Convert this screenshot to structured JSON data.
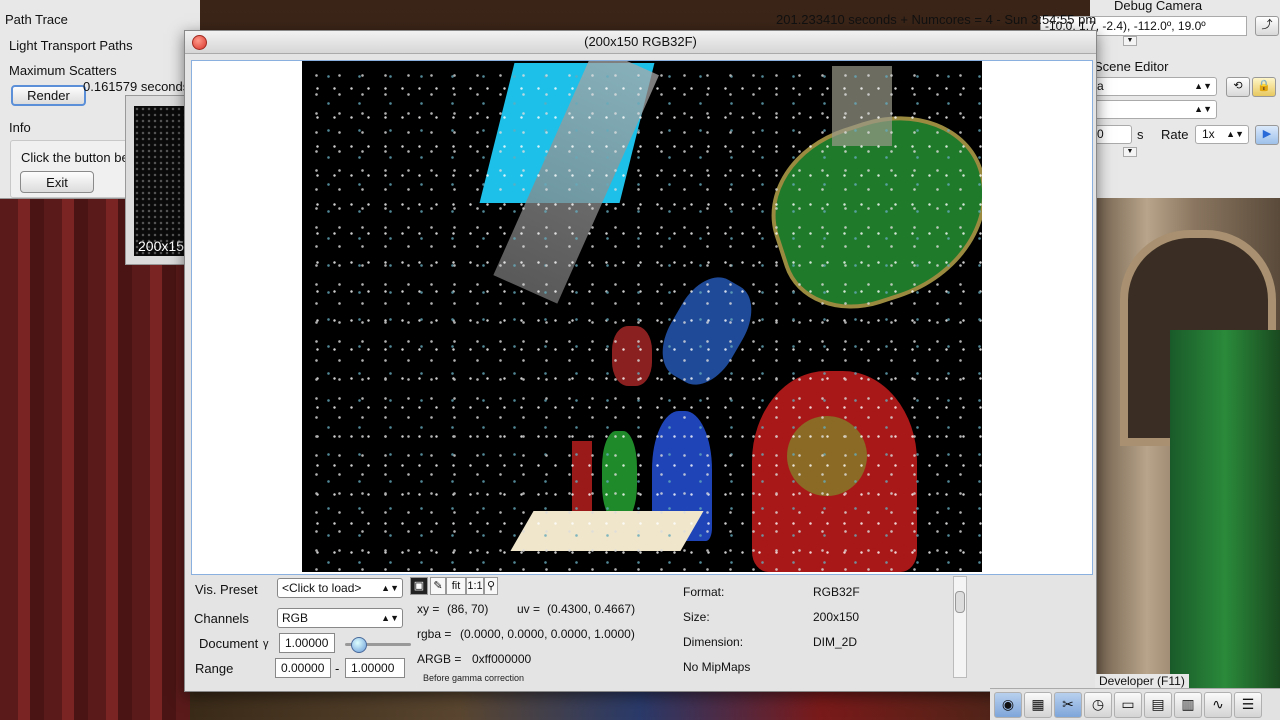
{
  "gui": {
    "panel_title": "Path Trace",
    "light_transport_label": "Light Transport Paths",
    "max_scatters_label": "Maximum Scatters",
    "render_button": "Render",
    "render_time": "0.161579 seconds",
    "info_label": "Info",
    "info_text": "Click the button be",
    "exit_button": "Exit",
    "thumbnail_caption": "200x15"
  },
  "status": {
    "text": "201.233410 seconds + Numcores = 4 - Sun 3:54:55 pm"
  },
  "debug_camera": {
    "title": "Debug Camera",
    "position": "-10.0, 1.7, -2.4), -112.0º, 19.0º"
  },
  "scene_editor": {
    "title": "Scene Editor",
    "scene_value": "a",
    "second_value": "",
    "time_value": "0",
    "time_unit": "s",
    "rate_label": "Rate",
    "rate_value": "1x"
  },
  "viewer": {
    "title": "(200x150 RGB32F)",
    "vis_preset_label": "Vis. Preset",
    "vis_preset_value": "<Click to load>",
    "channels_label": "Channels",
    "channels_value": "RGB",
    "document_label": "Document",
    "gamma_symbol": "γ",
    "gamma_value": "1.00000",
    "gamma_slider_fraction": 0.2,
    "range_label": "Range",
    "range_min": "0.00000",
    "range_sep": "-",
    "range_max": "1.00000",
    "fit_label": "fit",
    "one_to_one_label": "1:1",
    "xy_label": "xy =",
    "xy_value": "(86, 70)",
    "uv_label": "uv =",
    "uv_value": "(0.4300, 0.4667)",
    "rgba_label": "rgba =",
    "rgba_value": "(0.0000, 0.0000, 0.0000, 1.0000)",
    "argb_label": "ARGB =",
    "argb_value": "0xff000000",
    "gamma_note": "Before gamma correction",
    "format_label": "Format:",
    "format_value": "RGB32F",
    "size_label": "Size:",
    "size_value": "200x150",
    "dimension_label": "Dimension:",
    "dimension_value": "DIM_2D",
    "mipmaps_text": "No MipMaps"
  },
  "developer": {
    "label": "Developer (F11)",
    "tools": [
      "camera-icon",
      "film-icon",
      "tools-icon",
      "clock-icon",
      "page-icon",
      "terminal-icon",
      "window-icon",
      "graph-icon",
      "document-icon"
    ]
  }
}
